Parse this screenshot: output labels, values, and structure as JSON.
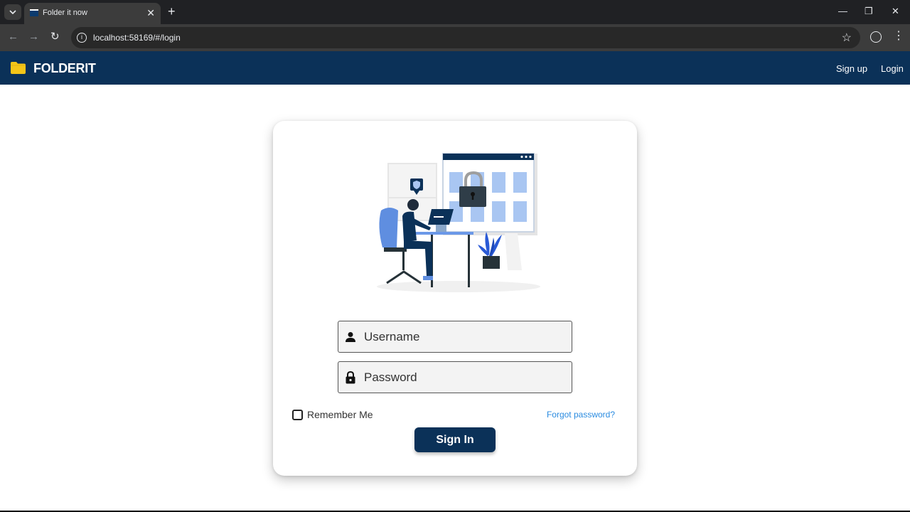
{
  "browser": {
    "tab_title": "Folder it now",
    "tab_close": "✕",
    "new_tab": "+",
    "url": "localhost:58169/#/login",
    "minimize": "—",
    "restore": "❐",
    "close": "✕",
    "back": "←",
    "forward": "→",
    "reload": "↻",
    "star": "☆",
    "menu": "⋮",
    "info": "i"
  },
  "header": {
    "brand": "FOLDERIT",
    "signup_label": "Sign up",
    "login_label": "Login",
    "colors": {
      "primary": "#0b3158",
      "logo": "#f5c518"
    }
  },
  "form": {
    "username_placeholder": "Username",
    "password_placeholder": "Password",
    "remember_label": "Remember Me",
    "forgot_label": "Forgot password?",
    "signin_label": "Sign In"
  },
  "illustration": {
    "alt": "security-illustration"
  }
}
